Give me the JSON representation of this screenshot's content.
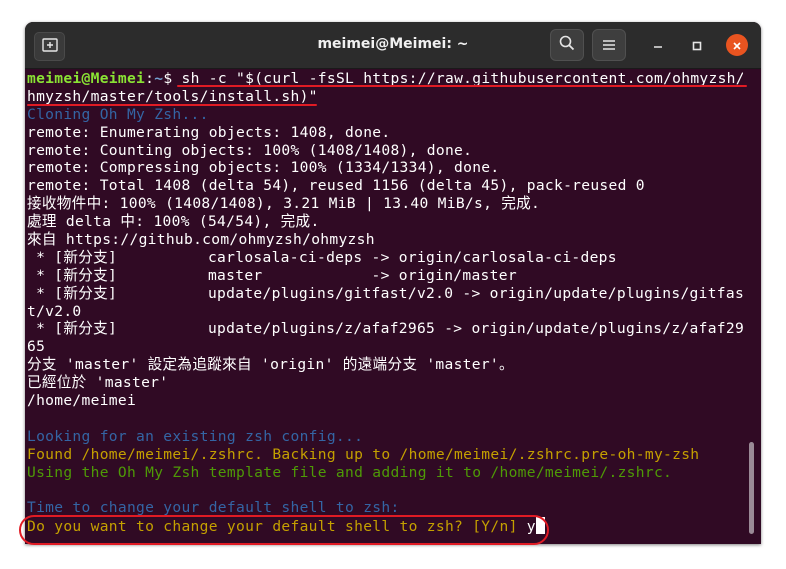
{
  "window": {
    "title": "meimei@Meimei: ~",
    "colors": {
      "background": "#300a24",
      "titlebar": "#2c2c2c",
      "close": "#e95420",
      "annotation": "#e01b24"
    },
    "icons": {
      "new_tab": "new-tab-icon",
      "search": "search-icon",
      "menu": "hamburger-menu-icon",
      "minimize": "minimize-icon",
      "maximize": "maximize-icon",
      "close": "close-icon"
    }
  },
  "terminal": {
    "prompt": {
      "user_host": "meimei@Meimei",
      "sep": ":",
      "dir": "~",
      "symbol": "$ ",
      "command_1": "sh -c \"$(curl -fsSL https://raw.githubusercontent.com/ohmyzsh/o",
      "command_2": "hmyzsh/master/tools/install.sh)\""
    },
    "lines": [
      "Cloning Oh My Zsh...",
      "remote: Enumerating objects: 1408, done.",
      "remote: Counting objects: 100% (1408/1408), done.",
      "remote: Compressing objects: 100% (1334/1334), done.",
      "remote: Total 1408 (delta 54), reused 1156 (delta 45), pack-reused 0",
      "接收物件中: 100% (1408/1408), 3.21 MiB | 13.40 MiB/s, 完成.",
      "處理 delta 中: 100% (54/54), 完成.",
      "來自 https://github.com/ohmyzsh/ohmyzsh",
      " * [新分支]          carlosala-ci-deps -> origin/carlosala-ci-deps",
      " * [新分支]          master            -> origin/master",
      " * [新分支]          update/plugins/gitfast/v2.0 -> origin/update/plugins/gitfas",
      "t/v2.0",
      " * [新分支]          update/plugins/z/afaf2965 -> origin/update/plugins/z/afaf29",
      "65",
      "分支 'master' 設定為追蹤來自 'origin' 的遠端分支 'master'。",
      "已經位於 'master'",
      "/home/meimei",
      "",
      "Looking for an existing zsh config...",
      "Found /home/meimei/.zshrc. Backing up to /home/meimei/.zshrc.pre-oh-my-zsh",
      "Using the Oh My Zsh template file and adding it to /home/meimei/.zshrc.",
      "",
      "Time to change your default shell to zsh:",
      "Do you want to change your default shell to zsh? [Y/n] "
    ],
    "input": "y"
  }
}
